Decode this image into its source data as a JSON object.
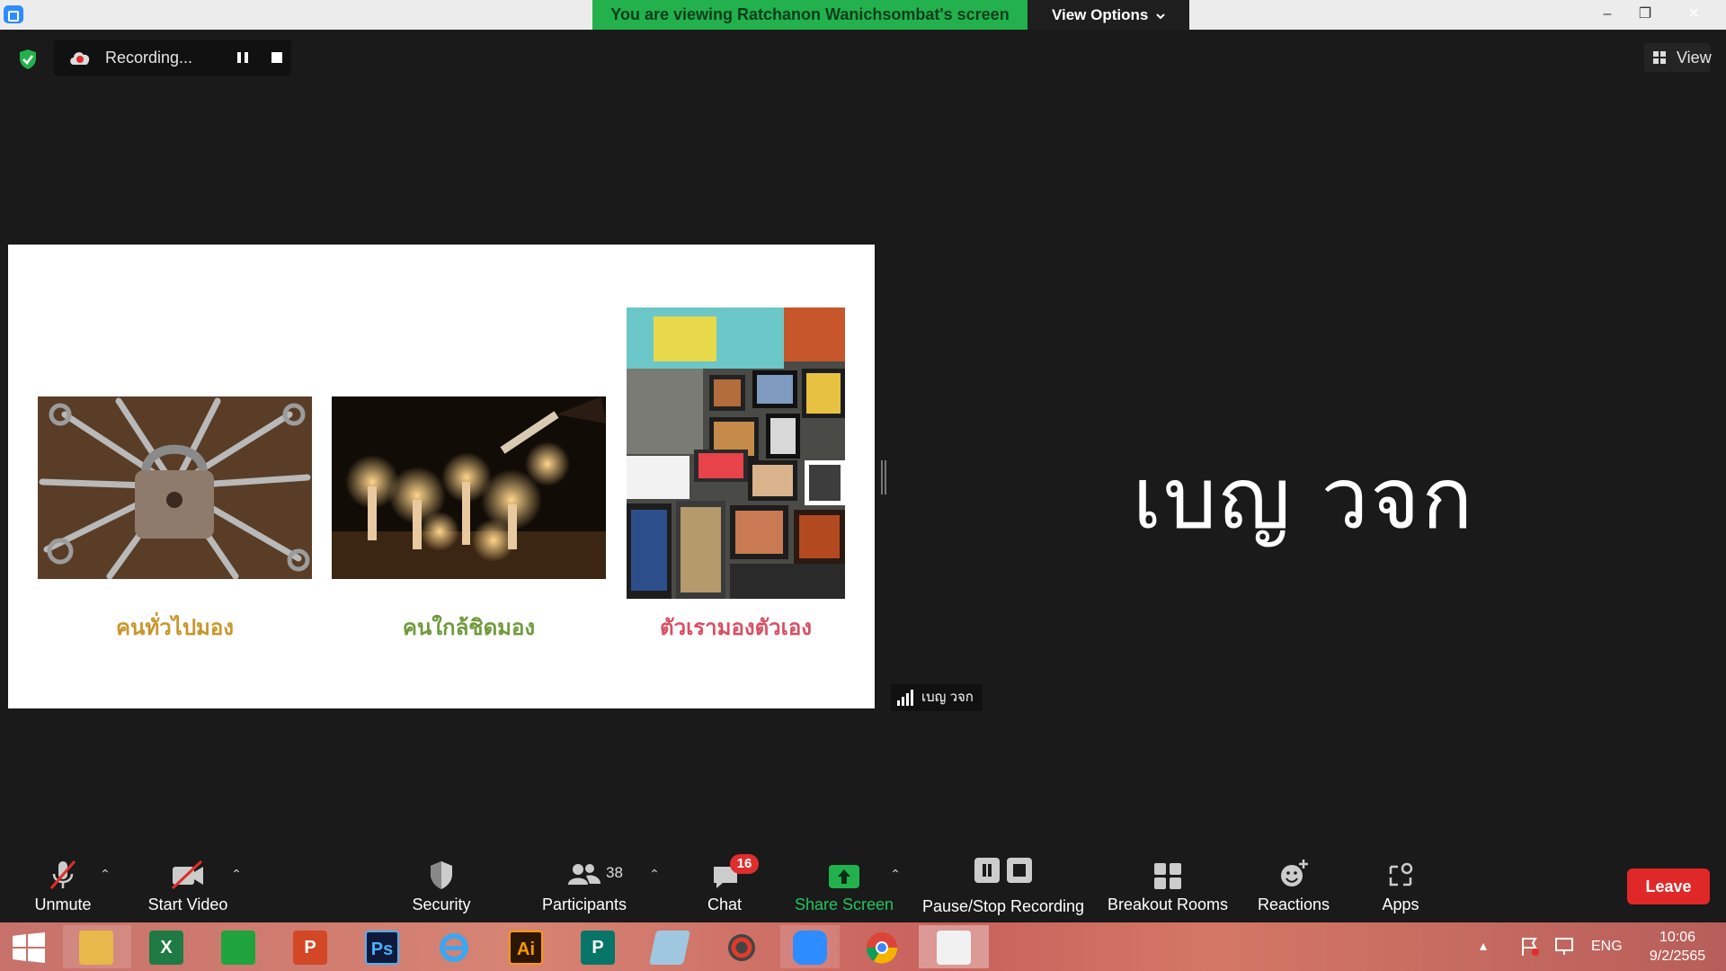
{
  "titlebar": {
    "banner": "You are viewing Ratchanon Wanichsombat's screen",
    "view_options": "View Options",
    "minimize": "‒",
    "restore": "❐",
    "close": "✕"
  },
  "recording": {
    "label": "Recording..."
  },
  "top_view": {
    "label": "View"
  },
  "slide": {
    "captions": [
      "คนทั่วไปมอง",
      "คนใกล้ชิดมอง",
      "ตัวเรามองตัวเอง"
    ],
    "caption_colors": [
      "#c8962a",
      "#6f9a3c",
      "#d94f62"
    ]
  },
  "speaker": {
    "name": "เบญ วจก",
    "tag": "เบญ วจก"
  },
  "toolbar": {
    "unmute": "Unmute",
    "start_video": "Start Video",
    "security": "Security",
    "participants": "Participants",
    "participants_count": "38",
    "chat": "Chat",
    "chat_badge": "16",
    "share_screen": "Share Screen",
    "recording": "Pause/Stop Recording",
    "breakout": "Breakout Rooms",
    "reactions": "Reactions",
    "apps": "Apps",
    "leave": "Leave"
  },
  "taskbar": {
    "apps": [
      "windows-start",
      "file-explorer",
      "excel",
      "store",
      "powerpoint",
      "photoshop",
      "internet-explorer",
      "illustrator",
      "publisher",
      "notepad",
      "photoscape",
      "zoom",
      "chrome",
      "powerpoint-active"
    ],
    "tiles": {
      "excel": "X",
      "powerpoint": "P",
      "photoshop": "Ps",
      "illustrator": "Ai",
      "publisher": "P"
    },
    "language": "ENG",
    "time": "10:06",
    "date": "9/2/2565"
  },
  "colors": {
    "accent_green": "#22b14c",
    "leave_red": "#e02828",
    "badge_red": "#e02d2d"
  }
}
